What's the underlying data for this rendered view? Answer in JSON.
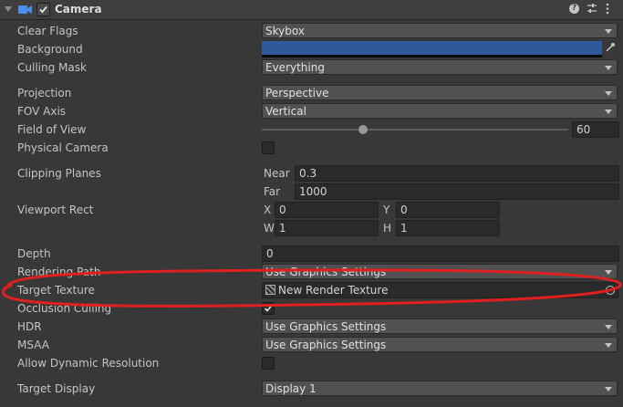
{
  "header": {
    "title": "Camera",
    "enabled": true,
    "icons": [
      "collapse-arrow-icon",
      "camera-icon",
      "help-icon",
      "preset-icon",
      "kebab-menu-icon"
    ]
  },
  "properties": {
    "clear_flags": {
      "label": "Clear Flags",
      "value": "Skybox"
    },
    "background": {
      "label": "Background",
      "color": "#2e5a9c"
    },
    "culling_mask": {
      "label": "Culling Mask",
      "value": "Everything"
    },
    "projection": {
      "label": "Projection",
      "value": "Perspective"
    },
    "fov_axis": {
      "label": "FOV Axis",
      "value": "Vertical"
    },
    "field_of_view": {
      "label": "Field of View",
      "value": "60",
      "slider_fraction": 0.33
    },
    "physical_camera": {
      "label": "Physical Camera",
      "checked": false
    },
    "clipping_planes": {
      "label": "Clipping Planes",
      "near_label": "Near",
      "near": "0.3",
      "far_label": "Far",
      "far": "1000"
    },
    "viewport_rect": {
      "label": "Viewport Rect",
      "x_label": "X",
      "x": "0",
      "y_label": "Y",
      "y": "0",
      "w_label": "W",
      "w": "1",
      "h_label": "H",
      "h": "1"
    },
    "depth": {
      "label": "Depth",
      "value": "0"
    },
    "rendering_path": {
      "label": "Rendering Path",
      "value": "Use Graphics Settings"
    },
    "target_texture": {
      "label": "Target Texture",
      "value": "New Render Texture"
    },
    "occlusion_culling": {
      "label": "Occlusion Culling",
      "checked": true
    },
    "hdr": {
      "label": "HDR",
      "value": "Use Graphics Settings"
    },
    "msaa": {
      "label": "MSAA",
      "value": "Use Graphics Settings"
    },
    "allow_dynamic_resolution": {
      "label": "Allow Dynamic Resolution",
      "checked": false
    },
    "target_display": {
      "label": "Target Display",
      "value": "Display 1"
    }
  },
  "annotation": {
    "color": "#e02020",
    "highlights": "target_texture"
  }
}
